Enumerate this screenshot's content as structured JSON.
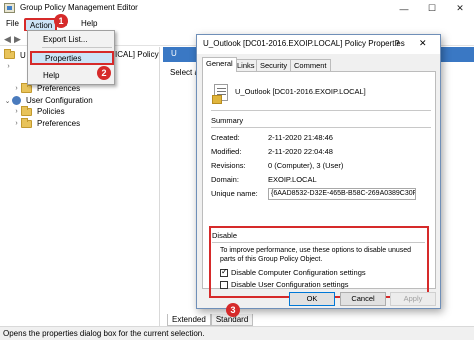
{
  "main_window": {
    "title": "Group Policy Management Editor",
    "controls": {
      "minimize": "—",
      "maximize": "☐",
      "close": "✕"
    }
  },
  "menu": {
    "file": "File",
    "action": "Action",
    "view": "v",
    "help": "Help"
  },
  "badges": {
    "one": "1",
    "two": "2",
    "three": "3"
  },
  "action_menu": {
    "items": [
      "Export List...",
      "Properties",
      "Help"
    ]
  },
  "tree": {
    "root_prefix": "U",
    "root_suffix": "ICAL] Policy",
    "items": [
      {
        "label": "Preferences"
      },
      {
        "label": "User Configuration"
      },
      {
        "label": "Policies"
      },
      {
        "label": "Preferences"
      }
    ]
  },
  "right_pane": {
    "header": "U",
    "text": "Select a"
  },
  "bottom_tabs": [
    "Extended",
    "Standard"
  ],
  "status_bar": "Opens the properties dialog box for the current selection.",
  "dialog": {
    "title": "U_Outlook [DC01-2016.EXOIP.LOCAL] Policy Properties",
    "help_button": "?",
    "close_button": "✕",
    "tabs": [
      "General",
      "Links",
      "Security",
      "Comment"
    ],
    "gpo_name": "U_Outlook [DC01-2016.EXOIP.LOCAL]",
    "summary": {
      "label": "Summary",
      "created_label": "Created:",
      "created": "2-11-2020 21:48:46",
      "modified_label": "Modified:",
      "modified": "2-11-2020 22:04:48",
      "revisions_label": "Revisions:",
      "revisions": "0 (Computer), 3 (User)",
      "domain_label": "Domain:",
      "domain": "EXOIP.LOCAL",
      "unique_name_label": "Unique name:",
      "unique_name": "{6AAD8532-D32E-465B-B58C-269A0389C30F}"
    },
    "disable": {
      "label": "Disable",
      "description": "To improve performance, use these options to disable unused parts of this Group Policy Object.",
      "computer_label": "Disable Computer Configuration settings",
      "computer_checked": true,
      "user_label": "Disable User Configuration settings",
      "user_checked": false
    },
    "buttons": {
      "ok": "OK",
      "cancel": "Cancel",
      "apply": "Apply"
    }
  }
}
